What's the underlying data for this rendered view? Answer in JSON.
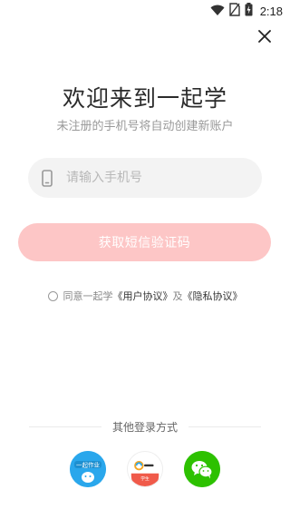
{
  "status_bar": {
    "time": "2:18"
  },
  "header": {
    "title": "欢迎来到一起学",
    "subtitle": "未注册的手机号将自动创建新账户"
  },
  "phone_field": {
    "placeholder": "请输入手机号"
  },
  "get_code_button": {
    "label": "获取短信验证码"
  },
  "agreement": {
    "prefix": "同意一起学",
    "user_agreement": "《用户协议》",
    "connector": "及",
    "privacy_agreement": "《隐私协议》"
  },
  "other_login": {
    "label": "其他登录方式",
    "options": [
      {
        "name": "一起作业",
        "icon": "yiqi-homework-icon"
      },
      {
        "name": "一起学生",
        "badge": "学生",
        "icon": "yiqi-student-icon"
      },
      {
        "name": "wechat",
        "icon": "wechat-icon"
      }
    ]
  },
  "colors": {
    "button_bg": "#fdc6c6",
    "field_bg": "#f3f3f3",
    "homework_blue": "#2aa7ec",
    "wechat_green": "#2dc100"
  }
}
